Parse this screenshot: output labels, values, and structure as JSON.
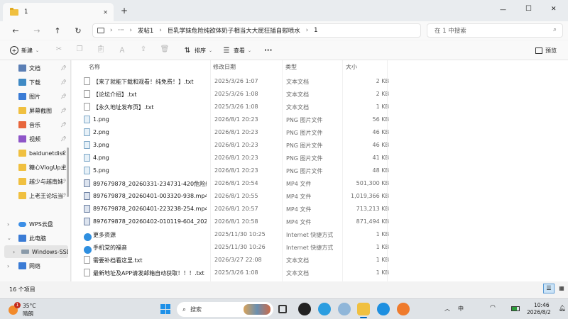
{
  "window": {
    "tab_title": "1",
    "new_tab": "+",
    "controls": {
      "minimize": "—",
      "maximize": "☐",
      "close": "✕"
    }
  },
  "address": {
    "more": "···",
    "crumbs": [
      "发帖1",
      "巨乳学妹危险纯欲体奶子相当大大屁狂插自慰喷水",
      "1"
    ],
    "separator": "›",
    "search_placeholder": "在 1 中搜索"
  },
  "toolbar": {
    "new_label": "新建",
    "sort_label": "排序",
    "view_label": "查看",
    "more": "···",
    "preview_label": "预览"
  },
  "sidebar": {
    "quick": [
      {
        "label": "文档",
        "icon": "documents-icon",
        "color": "#5b7fb5"
      },
      {
        "label": "下载",
        "icon": "downloads-icon",
        "color": "#3f8ac4"
      },
      {
        "label": "图片",
        "icon": "pictures-icon",
        "color": "#3a7bd5"
      },
      {
        "label": "屏幕截图",
        "icon": "folder-icon",
        "color": "#f0c040"
      },
      {
        "label": "音乐",
        "icon": "music-icon",
        "color": "#e8663c"
      },
      {
        "label": "视频",
        "icon": "videos-icon",
        "color": "#8e55c8"
      },
      {
        "label": "baidunetdisk",
        "icon": "folder-icon",
        "color": "#f0c040"
      },
      {
        "label": "糖心VlogUp主",
        "icon": "folder-icon",
        "color": "#f0c040"
      },
      {
        "label": "越少与越南妹",
        "icon": "folder-icon",
        "color": "#f0c040"
      },
      {
        "label": "上老王论坛当",
        "icon": "folder-icon",
        "color": "#f0c040"
      }
    ],
    "wps": "WPS云盘",
    "pc": "此电脑",
    "drive": "Windows-SSD",
    "network": "网络"
  },
  "columns": {
    "name": "名称",
    "date": "修改日期",
    "type": "类型",
    "size": "大小"
  },
  "files": [
    {
      "name": "【来了就能下载和观看！纯免费！】.txt",
      "date": "2025/3/26 1:07",
      "type": "文本文档",
      "size": "2 KB",
      "kind": "txt"
    },
    {
      "name": "【论坛介绍】.txt",
      "date": "2025/3/26 1:08",
      "type": "文本文档",
      "size": "2 KB",
      "kind": "txt"
    },
    {
      "name": "【永久地址发布页】.txt",
      "date": "2025/3/26 1:08",
      "type": "文本文档",
      "size": "1 KB",
      "kind": "txt"
    },
    {
      "name": "1.png",
      "date": "2026/8/1 20:23",
      "type": "PNG 图片文件",
      "size": "56 KB",
      "kind": "img"
    },
    {
      "name": "2.png",
      "date": "2026/8/1 20:23",
      "type": "PNG 图片文件",
      "size": "46 KB",
      "kind": "img"
    },
    {
      "name": "3.png",
      "date": "2026/8/1 20:23",
      "type": "PNG 图片文件",
      "size": "46 KB",
      "kind": "img"
    },
    {
      "name": "4.png",
      "date": "2026/8/1 20:23",
      "type": "PNG 图片文件",
      "size": "41 KB",
      "kind": "img"
    },
    {
      "name": "5.png",
      "date": "2026/8/1 20:23",
      "type": "PNG 图片文件",
      "size": "48 KB",
      "kind": "img"
    },
    {
      "name": "897679878_20260331-234731-420危险纯...",
      "date": "2026/8/1 20:54",
      "type": "MP4 文件",
      "size": "501,300 KB",
      "kind": "mp4"
    },
    {
      "name": "897679878_20260401-003320-938.mp4",
      "date": "2026/8/1 20:55",
      "type": "MP4 文件",
      "size": "1,019,366 KB",
      "kind": "mp4"
    },
    {
      "name": "897679878_20260401-223238-254.mp4",
      "date": "2026/8/1 20:57",
      "type": "MP4 文件",
      "size": "713,213 KB",
      "kind": "mp4"
    },
    {
      "name": "897679878_20260402-010119-604_20260...",
      "date": "2026/8/1 20:58",
      "type": "MP4 文件",
      "size": "871,494 KB",
      "kind": "mp4"
    },
    {
      "name": "更多资源",
      "date": "2025/11/30 10:25",
      "type": "Internet 快捷方式",
      "size": "1 KB",
      "kind": "lnk"
    },
    {
      "name": "手机党的福音",
      "date": "2025/11/30 10:26",
      "type": "Internet 快捷方式",
      "size": "1 KB",
      "kind": "lnk"
    },
    {
      "name": "需要补档看这里.txt",
      "date": "2026/3/27 22:08",
      "type": "文本文档",
      "size": "1 KB",
      "kind": "txt"
    },
    {
      "name": "最新地址及APP请发邮箱自动获取！！！.txt",
      "date": "2025/3/26 1:08",
      "type": "文本文档",
      "size": "1 KB",
      "kind": "txt"
    }
  ],
  "status": {
    "count": "16 个项目"
  },
  "taskbar": {
    "weather_badge": "1",
    "temp": "35°C",
    "weather": "晴朗",
    "search": "搜索",
    "time": "10:46",
    "date": "2026/8/2",
    "ime": "中"
  },
  "colors": {
    "accent": "#0067c0",
    "selected": "#cce4f7"
  }
}
